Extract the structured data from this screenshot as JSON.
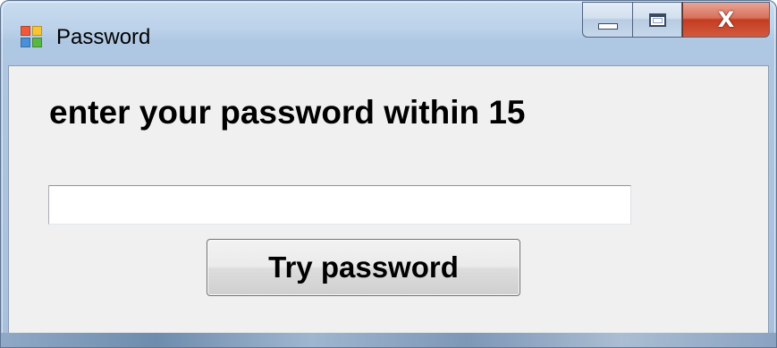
{
  "window": {
    "title": "Password",
    "icon": "app-window-icon",
    "close_glyph": "X"
  },
  "form": {
    "prompt": "enter your password within 15",
    "password_value": "",
    "password_placeholder": "",
    "submit_label": "Try password"
  },
  "colors": {
    "client_background": "#f0f0f0",
    "title_bar": "#bcd2ea",
    "close_button": "#c43c22"
  }
}
